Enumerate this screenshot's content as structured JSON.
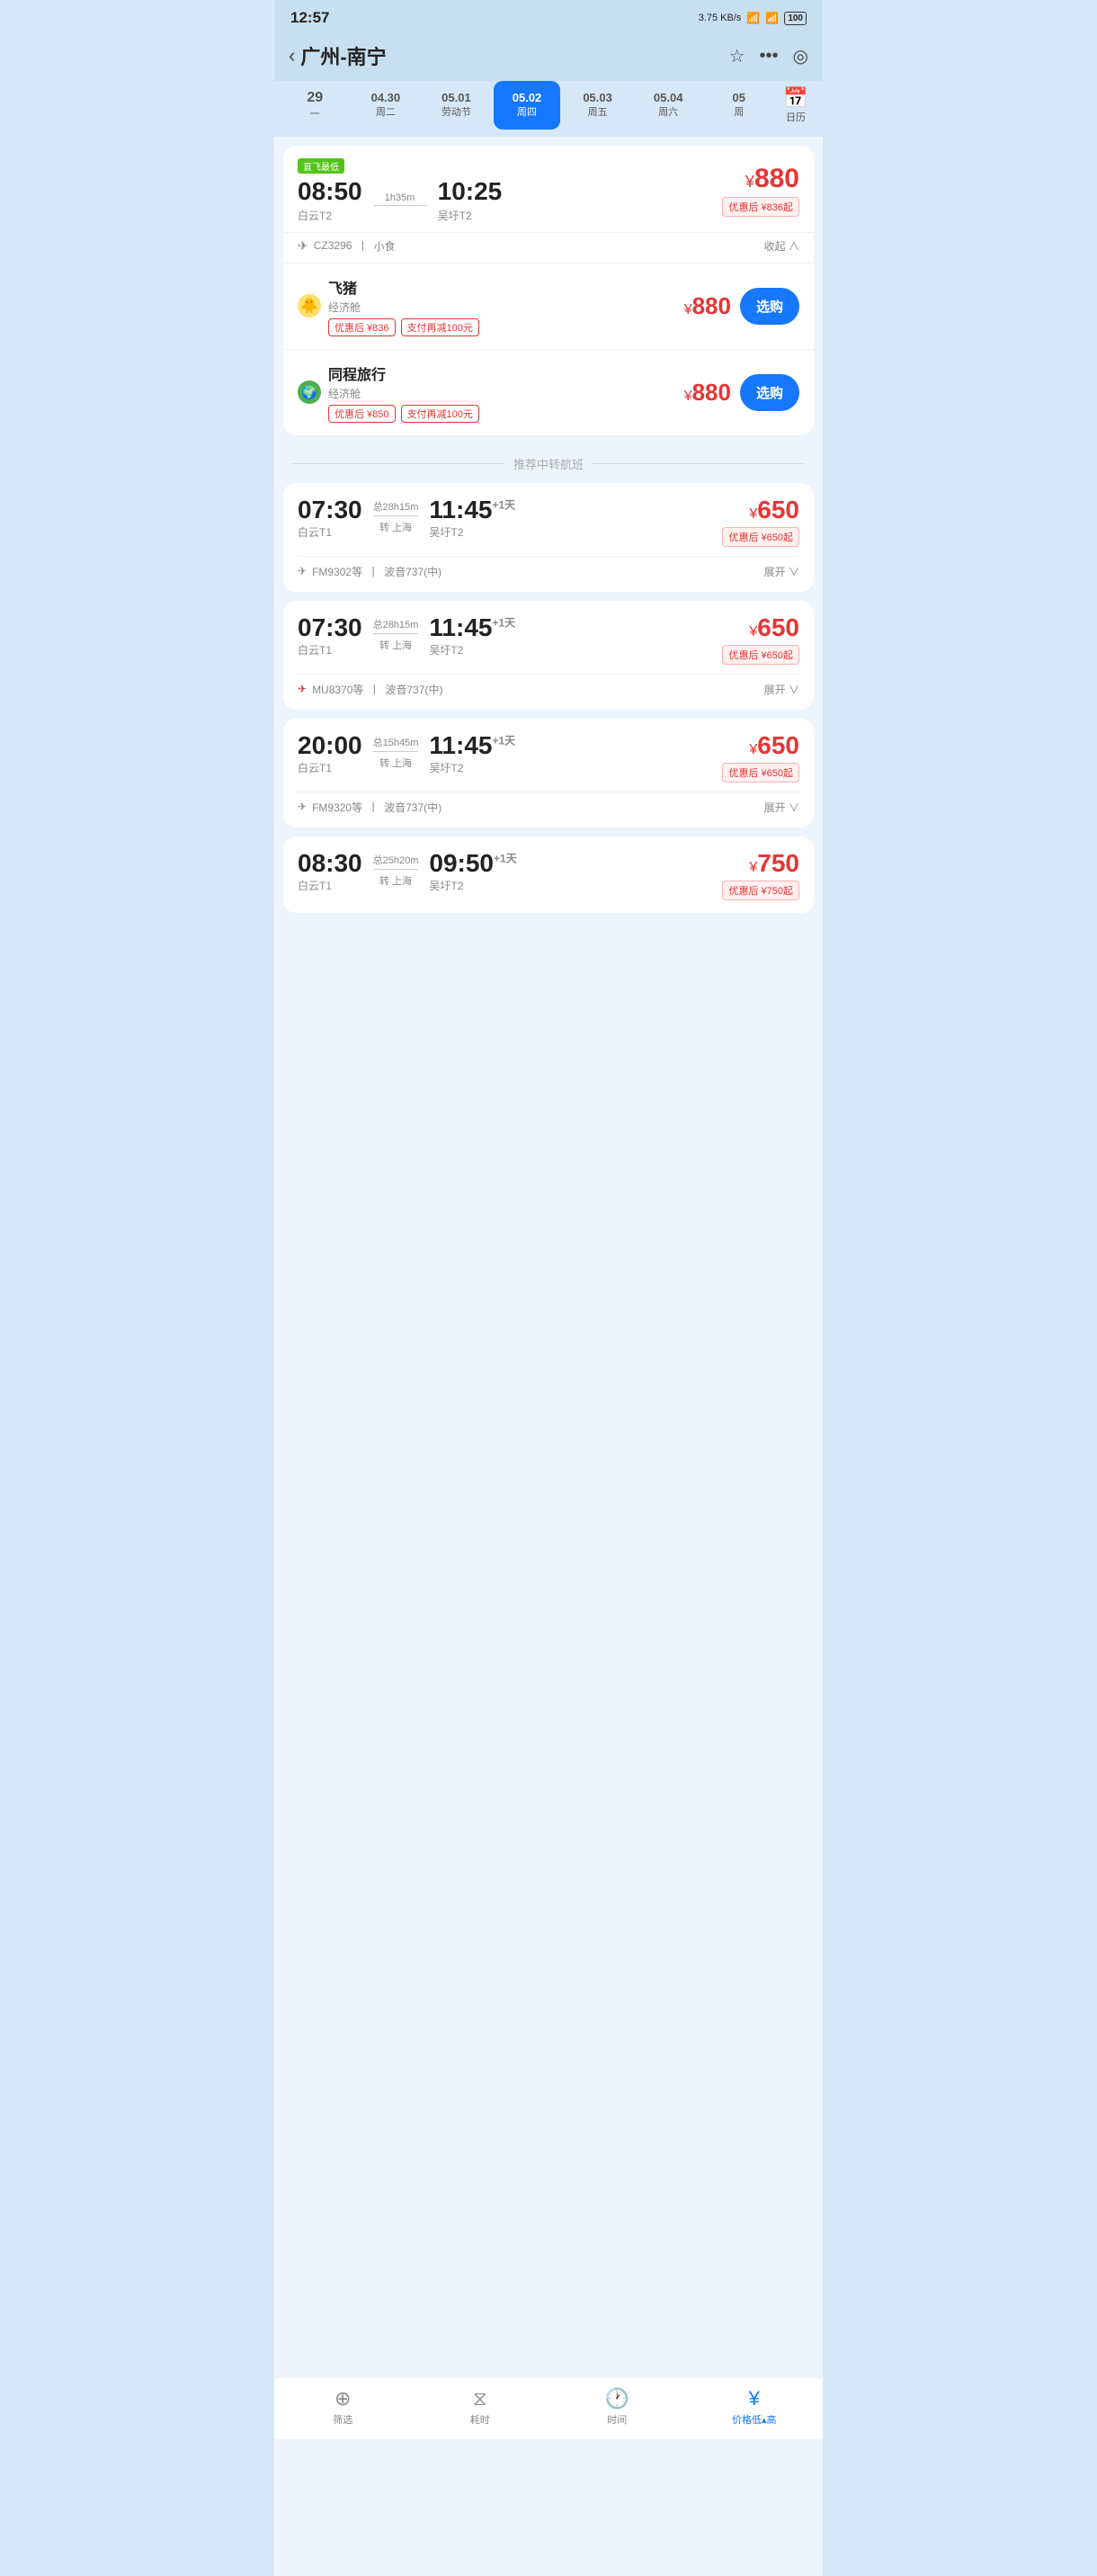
{
  "statusBar": {
    "time": "12:57",
    "signal": "3.75 KB/s",
    "battery": "100"
  },
  "header": {
    "back": "‹",
    "title": "广州-南宁",
    "star": "☆",
    "more": "•••",
    "target": "◎"
  },
  "dateTabs": [
    {
      "id": "tab-29",
      "num": "29",
      "label": "一",
      "active": false
    },
    {
      "id": "tab-0430",
      "num": "04.30",
      "label": "周二",
      "active": false
    },
    {
      "id": "tab-0501",
      "num": "05.01",
      "label": "劳动节",
      "active": false
    },
    {
      "id": "tab-0502",
      "num": "05.02",
      "label": "周四",
      "active": true
    },
    {
      "id": "tab-0503",
      "num": "05.03",
      "label": "周五",
      "active": false
    },
    {
      "id": "tab-0504",
      "num": "05.04",
      "label": "周六",
      "active": false
    },
    {
      "id": "tab-05",
      "num": "05",
      "label": "周",
      "active": false
    }
  ],
  "calendar": {
    "label": "日历"
  },
  "directBadge": "直飞最低",
  "mainFlight": {
    "dep": "08:50",
    "depTerminal": "白云T2",
    "duration": "1h35m",
    "arr": "10:25",
    "arrTerminal": "吴圩T2",
    "priceYen": "¥",
    "price": "880",
    "discountText": "优惠后 ¥836起",
    "airlineIcon": "✈",
    "flightNo": "CZ3296",
    "meal": "小食",
    "collapseLabel": "收起 ∧"
  },
  "subOptions": [
    {
      "logoEmoji": "🐥",
      "name": "飞猪",
      "cabin": "经济舱",
      "tags": [
        "优惠后 ¥836",
        "支付再减100元"
      ],
      "priceYen": "¥",
      "price": "880",
      "btnLabel": "选购"
    },
    {
      "logoEmoji": "🌍",
      "name": "同程旅行",
      "cabin": "经济舱",
      "tags": [
        "优惠后 ¥850",
        "支付再减100元"
      ],
      "priceYen": "¥",
      "price": "880",
      "btnLabel": "选购"
    }
  ],
  "sectionDivider": "推荐中转航班",
  "transferFlights": [
    {
      "dep": "07:30",
      "depTerminal": "白云T1",
      "totalDuration": "总28h15m",
      "via": "转 上海",
      "arr": "11:45",
      "arrPlus": "+1天",
      "arrTerminal": "吴圩T2",
      "priceYen": "¥",
      "price": "650",
      "discountText": "优惠后 ¥650起",
      "airlineIcon": "✈",
      "flightNo": "FM9302等",
      "aircraft": "波音737(中)",
      "expandLabel": "展开 ∨"
    },
    {
      "dep": "07:30",
      "depTerminal": "白云T1",
      "totalDuration": "总28h15m",
      "via": "转 上海",
      "arr": "11:45",
      "arrPlus": "+1天",
      "arrTerminal": "吴圩T2",
      "priceYen": "¥",
      "price": "650",
      "discountText": "优惠后 ¥650起",
      "airlineIcon": "✈",
      "flightNo": "MU8370等",
      "aircraft": "波音737(中)",
      "expandLabel": "展开 ∨"
    },
    {
      "dep": "20:00",
      "depTerminal": "白云T1",
      "totalDuration": "总15h45m",
      "via": "转 上海",
      "arr": "11:45",
      "arrPlus": "+1天",
      "arrTerminal": "吴圩T2",
      "priceYen": "¥",
      "price": "650",
      "discountText": "优惠后 ¥650起",
      "airlineIcon": "✈",
      "flightNo": "FM9320等",
      "aircraft": "波音737(中)",
      "expandLabel": "展开 ∨"
    },
    {
      "dep": "08:30",
      "depTerminal": "白云T1",
      "totalDuration": "总25h20m",
      "via": "转 上海",
      "arr": "09:50",
      "arrPlus": "+1天",
      "arrTerminal": "吴圩T2",
      "priceYen": "¥",
      "price": "750",
      "discountText": "优惠后 ¥750起",
      "airlineIcon": "✈",
      "flightNo": "",
      "aircraft": "",
      "expandLabel": ""
    }
  ],
  "bottomNav": [
    {
      "id": "nav-filter",
      "icon": "⊕",
      "label": "筛选",
      "active": false
    },
    {
      "id": "nav-duration",
      "icon": "⧖",
      "label": "耗时",
      "active": false
    },
    {
      "id": "nav-time",
      "icon": "⊙",
      "label": "时间",
      "active": false
    },
    {
      "id": "nav-price",
      "icon": "¥",
      "label": "价格低▴高",
      "active": true
    }
  ]
}
